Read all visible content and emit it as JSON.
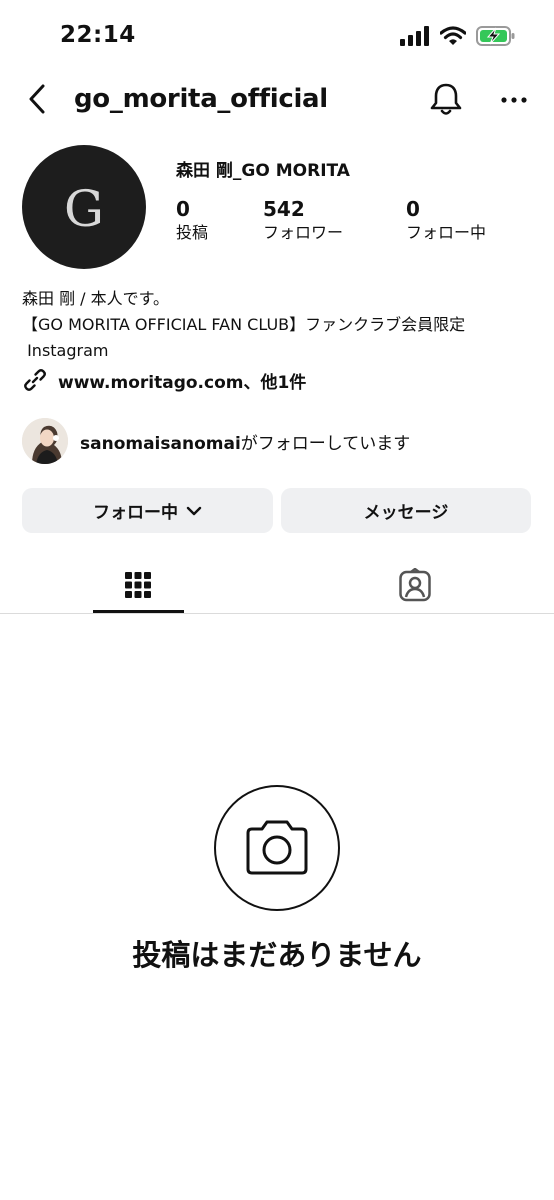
{
  "status_bar": {
    "time": "22:14",
    "icons": [
      "signal-icon",
      "wifi-icon",
      "battery-charging-icon"
    ]
  },
  "header": {
    "username": "go_morita_official",
    "icons": [
      "back-arrow-icon",
      "bell-icon",
      "more-icon"
    ]
  },
  "profile": {
    "avatar_letter": "G",
    "display_name": "森田 剛_GO MORITA",
    "stats": [
      {
        "value": "0",
        "label": "投稿"
      },
      {
        "value": "542",
        "label": "フォロワー"
      },
      {
        "value": "0",
        "label": "フォロー中"
      }
    ],
    "bio": [
      "森田 剛 / 本人です。",
      "【GO MORITA OFFICIAL FAN CLUB】ファンクラブ会員限定",
      " Instagram"
    ],
    "link_text": "www.moritago.com、他1件",
    "followed_by_user": "sanomaisanomai",
    "followed_by_suffix": "がフォローしています"
  },
  "actions": {
    "follow_label": "フォロー中",
    "message_label": "メッセージ"
  },
  "tabs": [
    "posts-grid-icon",
    "tagged-icon"
  ],
  "empty_state": {
    "title": "投稿はまだありません"
  },
  "colors": {
    "button_bg": "#eff0f2",
    "avatar_bg": "#1d1d1d",
    "battery_green": "#34c759"
  }
}
